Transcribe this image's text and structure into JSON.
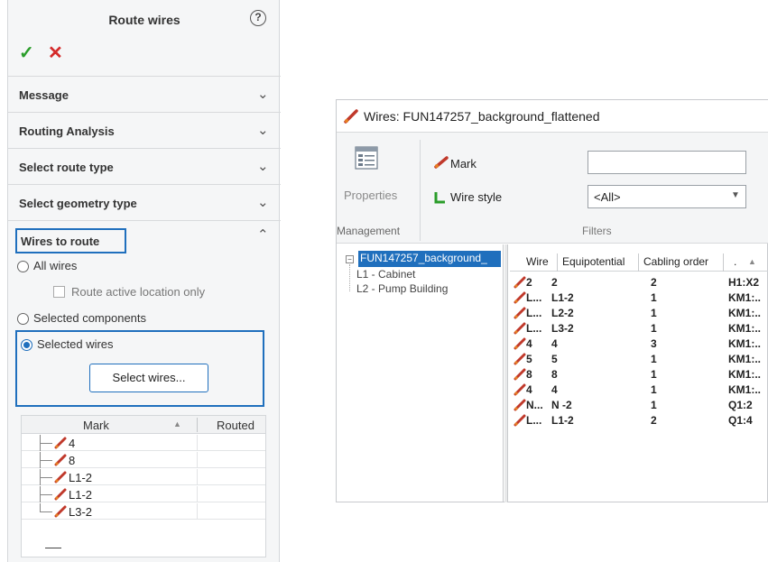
{
  "panel": {
    "title": "Route wires",
    "help_icon": "?",
    "sections": [
      "Message",
      "Routing Analysis",
      "Select route type",
      "Select geometry type"
    ],
    "wires_to_route": "Wires to route",
    "options": {
      "all_wires": "All wires",
      "route_active": "Route active location only",
      "selected_components": "Selected components",
      "selected_wires": "Selected wires"
    },
    "select_button": "Select wires...",
    "grid": {
      "col_mark": "Mark",
      "col_routed": "Routed",
      "rows": [
        "4",
        "8",
        "L1-2",
        "L1-2",
        "L3-2"
      ]
    }
  },
  "window": {
    "title": "Wires: FUN147257_background_flattened",
    "ribbon": {
      "properties": "Properties",
      "management": "Management",
      "mark_label": "Mark",
      "wire_style_label": "Wire style",
      "wire_style_value": "<All>",
      "filters": "Filters"
    },
    "tree": {
      "root": "FUN147257_background_",
      "children": [
        "L1 - Cabinet",
        "L2 - Pump Building"
      ]
    },
    "table": {
      "headers": [
        "Wire",
        "Equipotential",
        "Cabling order",
        "."
      ],
      "rows": [
        [
          "2",
          "2",
          "2",
          "H1:X2"
        ],
        [
          "L...",
          "L1-2",
          "1",
          "KM1:.."
        ],
        [
          "L...",
          "L2-2",
          "1",
          "KM1:.."
        ],
        [
          "L...",
          "L3-2",
          "1",
          "KM1:.."
        ],
        [
          "4",
          "4",
          "3",
          "KM1:.."
        ],
        [
          "5",
          "5",
          "1",
          "KM1:.."
        ],
        [
          "8",
          "8",
          "1",
          "KM1:.."
        ],
        [
          "4",
          "4",
          "1",
          "KM1:.."
        ],
        [
          "N...",
          "N -2",
          "1",
          "Q1:2"
        ],
        [
          "L...",
          "L1-2",
          "2",
          "Q1:4"
        ]
      ]
    }
  },
  "colors": {
    "accent": "#1f6fbd",
    "ok": "#2a9d2a",
    "cancel": "#d42a2a",
    "wire_icon": "#c0392b"
  }
}
